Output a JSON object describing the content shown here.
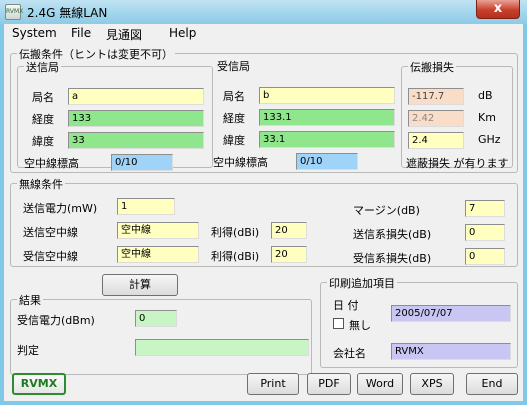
{
  "window": {
    "title": "2.4G 無線LAN",
    "icon_text": "RVMX",
    "close_symbol": "x"
  },
  "menu": [
    "System",
    "File",
    "見通図",
    "Help"
  ],
  "propagation": {
    "legend": "伝搬条件（ヒントは変更不可）",
    "tx": {
      "legend": "送信局",
      "name_label": "局名",
      "name": "a",
      "lon_label": "経度",
      "lon": "133",
      "lat_label": "緯度",
      "lat": "33",
      "height_label": "空中線標高",
      "height": "0/10"
    },
    "rx": {
      "legend": "受信局",
      "name_label": "局名",
      "name": "b",
      "lon_label": "経度",
      "lon": "133.1",
      "lat_label": "緯度",
      "lat": "33.1",
      "height_label": "空中線標高",
      "height": "0/10"
    },
    "loss": {
      "legend": "伝搬損失",
      "db": "-117.7",
      "db_unit": "dB",
      "km": "2.42",
      "km_unit": "Km",
      "ghz": "2.4",
      "ghz_unit": "GHz",
      "note": "遮蔽損失 が有ります"
    }
  },
  "radio": {
    "legend": "無線条件",
    "tx_power_label": "送信電力(mW)",
    "tx_power": "1",
    "tx_antenna_label": "送信空中線",
    "tx_antenna": "空中線",
    "rx_antenna_label": "受信空中線",
    "rx_antenna": "空中線",
    "gain_label": "利得(dBi)",
    "tx_gain": "20",
    "rx_gain": "20",
    "margin_label": "マージン(dB)",
    "margin": "7",
    "tx_loss_label": "送信系損失(dB)",
    "tx_loss": "0",
    "rx_loss_label": "受信系損失(dB)",
    "rx_loss": "0"
  },
  "calc_button": "計算",
  "result": {
    "legend": "結果",
    "rx_power_label": "受信電力(dBm)",
    "rx_power": "0",
    "judge_label": "判定",
    "judge": ""
  },
  "print_extra": {
    "legend": "印刷追加項目",
    "date_label": "日 付",
    "none_label": "無し",
    "date": "2005/07/07",
    "company_label": "会社名",
    "company": "RVMX"
  },
  "buttons": {
    "logo": "RVMX",
    "print": "Print",
    "pdf": "PDF",
    "word": "Word",
    "xps": "XPS",
    "end": "End"
  }
}
